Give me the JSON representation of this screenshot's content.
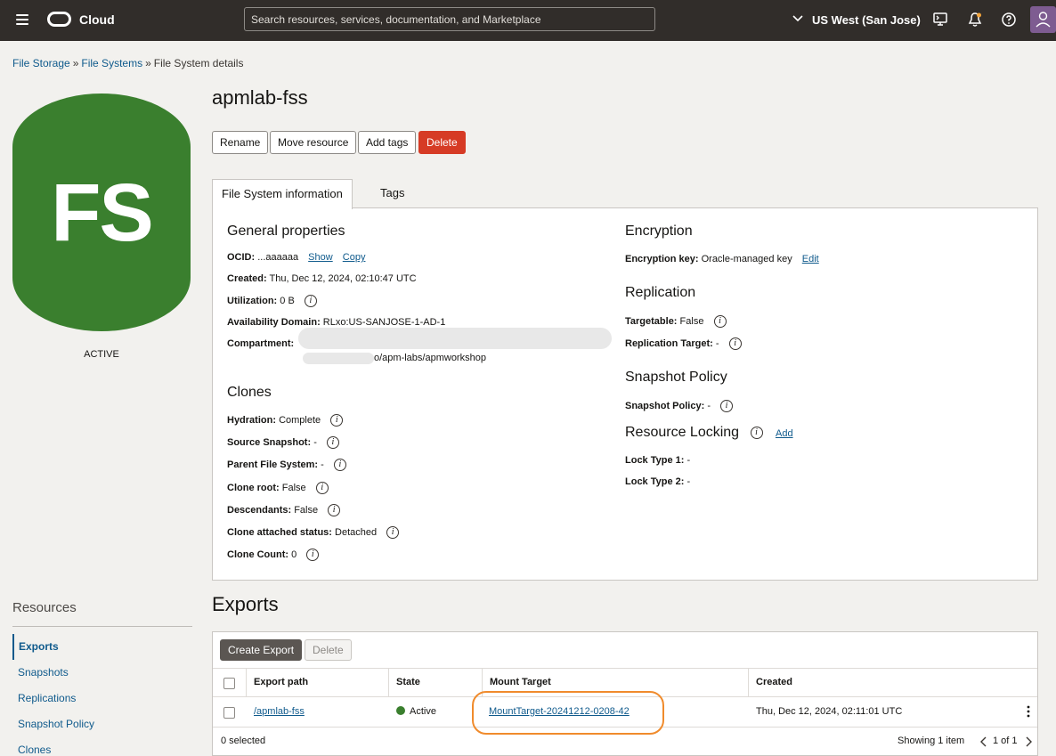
{
  "header": {
    "brand": "Cloud",
    "search_placeholder": "Search resources, services, documentation, and Marketplace",
    "region": "US West (San Jose)"
  },
  "breadcrumb": {
    "items": [
      "File Storage",
      "File Systems",
      "File System details"
    ]
  },
  "badge": {
    "text": "FS",
    "status": "ACTIVE",
    "color": "#3a7f2e"
  },
  "page": {
    "title": "apmlab-fss"
  },
  "actions": {
    "rename": "Rename",
    "move": "Move resource",
    "add_tags": "Add tags",
    "delete": "Delete"
  },
  "tabs": {
    "info": "File System information",
    "tags": "Tags"
  },
  "general": {
    "title": "General properties",
    "ocid_label": "OCID:",
    "ocid_value": "...aaaaaa",
    "ocid_show": "Show",
    "ocid_copy": "Copy",
    "created_label": "Created:",
    "created_value": "Thu, Dec 12, 2024, 02:10:47 UTC",
    "util_label": "Utilization:",
    "util_value": "0 B",
    "ad_label": "Availability Domain:",
    "ad_value": "RLxo:US-SANJOSE-1-AD-1",
    "compartment_label": "Compartment:",
    "compartment_value": "o/apm-labs/apmworkshop"
  },
  "clones": {
    "title": "Clones",
    "hydration_label": "Hydration:",
    "hydration_value": "Complete",
    "source_label": "Source Snapshot:",
    "source_value": "-",
    "parent_label": "Parent File System:",
    "parent_value": "-",
    "root_label": "Clone root:",
    "root_value": "False",
    "desc_label": "Descendants:",
    "desc_value": "False",
    "attached_label": "Clone attached status:",
    "attached_value": "Detached",
    "count_label": "Clone Count:",
    "count_value": "0"
  },
  "encryption": {
    "title": "Encryption",
    "key_label": "Encryption key:",
    "key_value": "Oracle-managed key",
    "edit": "Edit"
  },
  "replication": {
    "title": "Replication",
    "targetable_label": "Targetable:",
    "targetable_value": "False",
    "target_label": "Replication Target:",
    "target_value": "-"
  },
  "snapshot_policy": {
    "title": "Snapshot Policy",
    "label": "Snapshot Policy:",
    "value": "-"
  },
  "locking": {
    "title": "Resource Locking",
    "add": "Add",
    "lock1_label": "Lock Type 1:",
    "lock1_value": "-",
    "lock2_label": "Lock Type 2:",
    "lock2_value": "-"
  },
  "resources": {
    "title": "Resources",
    "items": [
      "Exports",
      "Snapshots",
      "Replications",
      "Snapshot Policy",
      "Clones"
    ]
  },
  "exports": {
    "title": "Exports",
    "create": "Create Export",
    "delete": "Delete",
    "columns": [
      "Export path",
      "State",
      "Mount Target",
      "Created"
    ],
    "rows": [
      {
        "path": "/apmlab-fss",
        "state": "Active",
        "mount_target": "MountTarget-20241212-0208-42",
        "created": "Thu, Dec 12, 2024, 02:11:01 UTC"
      }
    ],
    "selected": "0 selected",
    "showing": "Showing 1 item",
    "pages": "1 of 1"
  },
  "colors": {
    "header_bg": "#312d2a",
    "link": "#0f5a8c",
    "danger": "#d63b25",
    "active_green": "#3a7f2e",
    "highlight": "#f08b2c"
  }
}
